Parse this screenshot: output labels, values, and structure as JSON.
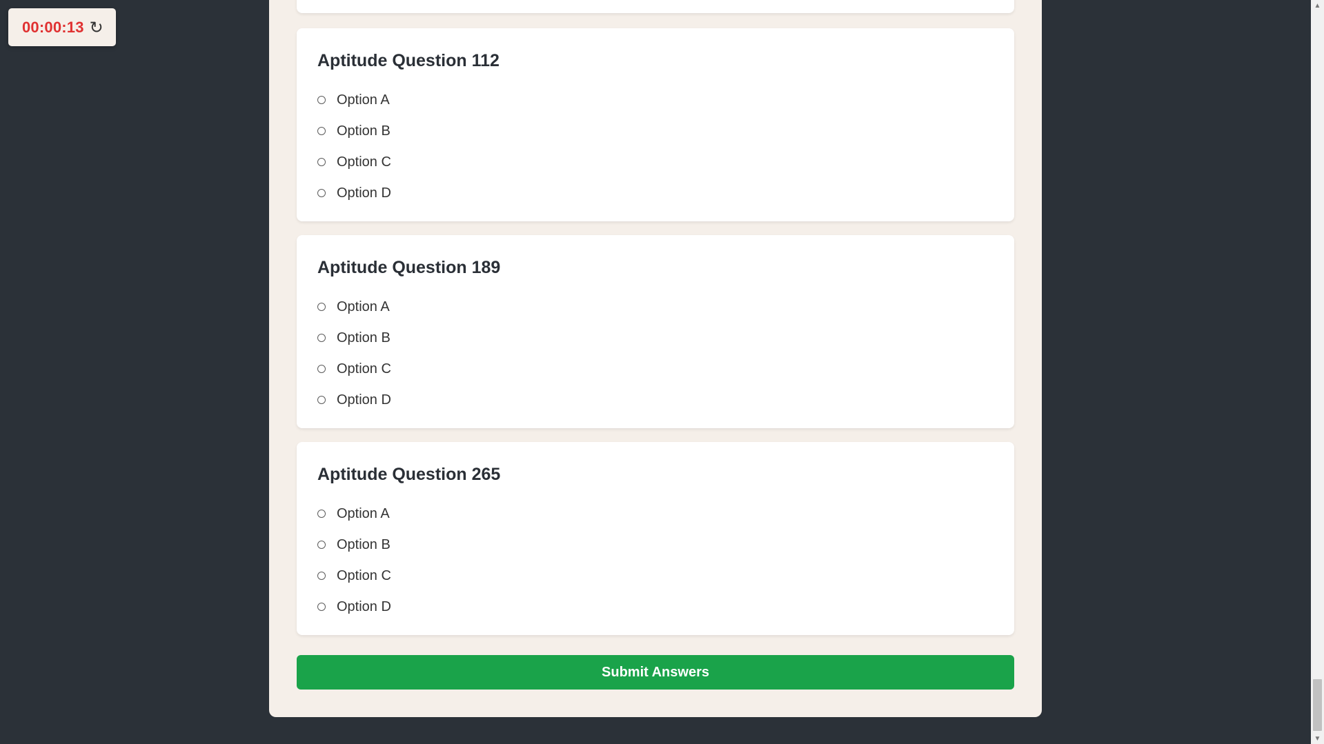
{
  "timer": {
    "time": "00:00:13",
    "reset_icon": "↻"
  },
  "questions": [
    {
      "title": "Aptitude Question 112",
      "options": [
        "Option A",
        "Option B",
        "Option C",
        "Option D"
      ]
    },
    {
      "title": "Aptitude Question 189",
      "options": [
        "Option A",
        "Option B",
        "Option C",
        "Option D"
      ]
    },
    {
      "title": "Aptitude Question 265",
      "options": [
        "Option A",
        "Option B",
        "Option C",
        "Option D"
      ]
    }
  ],
  "submit": {
    "label": "Submit Answers"
  },
  "scrollbar": {
    "up_arrow": "▲",
    "down_arrow": "▼"
  },
  "colors": {
    "page_background": "#2b3138",
    "container_background": "#f5efe9",
    "timer_text": "#e03131",
    "submit_button": "#1aa34a"
  }
}
